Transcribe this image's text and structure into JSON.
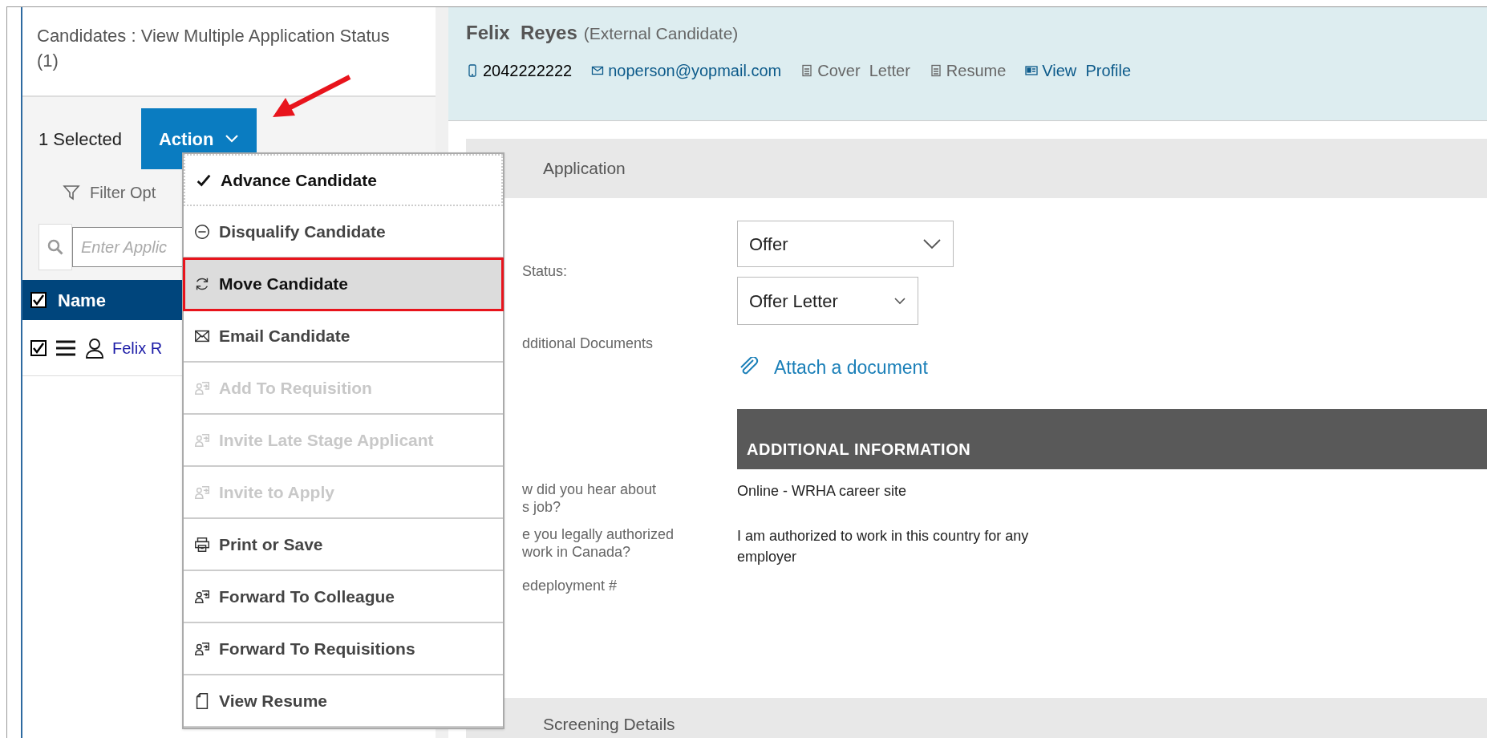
{
  "left_panel": {
    "title": "Candidates : View Multiple Application Status (1)",
    "selected_count": "1 Selected",
    "action_button": "Action",
    "filter": "Filter Opt",
    "search": {
      "placeholder": "Enter Applic"
    },
    "table": {
      "header": {
        "label": "Name",
        "checked": true
      },
      "rows": [
        {
          "name": "Felix R",
          "checked": true
        }
      ]
    }
  },
  "action_menu": [
    {
      "label": "Advance Candidate",
      "kind": "check",
      "disabled": false,
      "focused": true,
      "highlighted": false
    },
    {
      "label": "Disqualify Candidate",
      "kind": "minus-circle",
      "disabled": false,
      "focused": false,
      "highlighted": false
    },
    {
      "label": "Move Candidate",
      "kind": "refresh",
      "disabled": false,
      "focused": false,
      "highlighted": true
    },
    {
      "label": "Email Candidate",
      "kind": "mail",
      "disabled": false,
      "focused": false,
      "highlighted": false
    },
    {
      "label": "Add To Requisition",
      "kind": "person-forward",
      "disabled": true,
      "focused": false,
      "highlighted": false
    },
    {
      "label": "Invite Late Stage Applicant",
      "kind": "person-forward",
      "disabled": true,
      "focused": false,
      "highlighted": false
    },
    {
      "label": "Invite to Apply",
      "kind": "person-forward",
      "disabled": true,
      "focused": false,
      "highlighted": false
    },
    {
      "label": "Print or Save",
      "kind": "printer",
      "disabled": false,
      "focused": false,
      "highlighted": false
    },
    {
      "label": "Forward To Colleague",
      "kind": "person-forward",
      "disabled": false,
      "focused": false,
      "highlighted": false
    },
    {
      "label": "Forward To Requisitions",
      "kind": "person-forward",
      "disabled": false,
      "focused": false,
      "highlighted": false
    },
    {
      "label": "View Resume",
      "kind": "document",
      "disabled": false,
      "focused": false,
      "highlighted": false
    }
  ],
  "candidate": {
    "name": "Felix  Reyes",
    "type": "(External Candidate)",
    "contacts": [
      {
        "kind": "phone",
        "label": "2042222222"
      },
      {
        "kind": "email",
        "label": "noperson@yopmail.com"
      },
      {
        "kind": "cover-letter",
        "label": "Cover  Letter"
      },
      {
        "kind": "resume",
        "label": "Resume"
      },
      {
        "kind": "profile",
        "label": "View  Profile"
      }
    ]
  },
  "application": {
    "title": "Application",
    "status_label": "Status:",
    "status": "Offer",
    "sub_status": "Offer Letter",
    "documents_label": "dditional Documents",
    "attach": "Attach a document",
    "section_title": "ADDITIONAL INFORMATION",
    "questions": [
      {
        "question_lines": [
          "w did you hear about",
          "s job?"
        ],
        "answer": "Online - WRHA career site"
      },
      {
        "question_lines": [
          "e you legally authorized",
          "work in Canada?"
        ],
        "answer": "I am authorized to work in this country for any employer"
      },
      {
        "question_lines": [
          "edeployment #"
        ]
      }
    ]
  },
  "screening": {
    "title": "Screening Details"
  }
}
